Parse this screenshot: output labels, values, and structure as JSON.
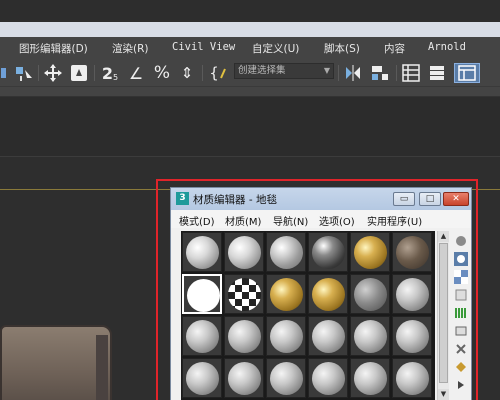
{
  "app": {
    "menu": [
      {
        "id": "graph",
        "label": "图形编辑器(D)"
      },
      {
        "id": "render",
        "label": "渲染(R)"
      },
      {
        "id": "civil",
        "label": "Civil View"
      },
      {
        "id": "custom",
        "label": "自定义(U)"
      },
      {
        "id": "script",
        "label": "脚本(S)"
      },
      {
        "id": "content",
        "label": "内容"
      },
      {
        "id": "arnold",
        "label": "Arnold"
      }
    ],
    "toolbar": {
      "snap_2d": "2",
      "snap_2d_sub": "5",
      "angle_snap": "∠",
      "percent_snap": "%",
      "spinner_snap": "⇕",
      "named_sel_brace": "{",
      "selection_set_placeholder": "创建选择集",
      "dropdown_arrow": "▼"
    }
  },
  "material_editor": {
    "logo": "3",
    "title": "材质编辑器 - 地毯",
    "window_buttons": {
      "minimize": "▭",
      "restore": "□",
      "close": "✕"
    },
    "menu": [
      {
        "id": "modes",
        "label": "模式(D)"
      },
      {
        "id": "material",
        "label": "材质(M)"
      },
      {
        "id": "navigation",
        "label": "导航(N)"
      },
      {
        "id": "options",
        "label": "选项(O)"
      },
      {
        "id": "utilities",
        "label": "实用程序(U)"
      }
    ],
    "scroll_up": "▲",
    "scroll_down": "▼",
    "slots": [
      {
        "kind": "gray-white"
      },
      {
        "kind": "gray-white"
      },
      {
        "kind": "marble"
      },
      {
        "kind": "dark-chrome"
      },
      {
        "kind": "gold"
      },
      {
        "kind": "dark-textured"
      },
      {
        "kind": "white"
      },
      {
        "kind": "checker"
      },
      {
        "kind": "gold"
      },
      {
        "kind": "gold"
      },
      {
        "kind": "gray-textured"
      },
      {
        "kind": "gray"
      },
      {
        "kind": "gray"
      },
      {
        "kind": "gray"
      },
      {
        "kind": "gray"
      },
      {
        "kind": "gray"
      },
      {
        "kind": "gray"
      },
      {
        "kind": "gray"
      },
      {
        "kind": "gray"
      },
      {
        "kind": "gray"
      },
      {
        "kind": "gray"
      },
      {
        "kind": "gray"
      },
      {
        "kind": "gray"
      },
      {
        "kind": "gray"
      }
    ],
    "selected_slot": 6
  },
  "colors": {
    "highlight_box": "#e0242a",
    "viewport_bg": "#2e2e2e",
    "menubar_bg": "#444444",
    "titlebar": "#b4c8e2"
  }
}
